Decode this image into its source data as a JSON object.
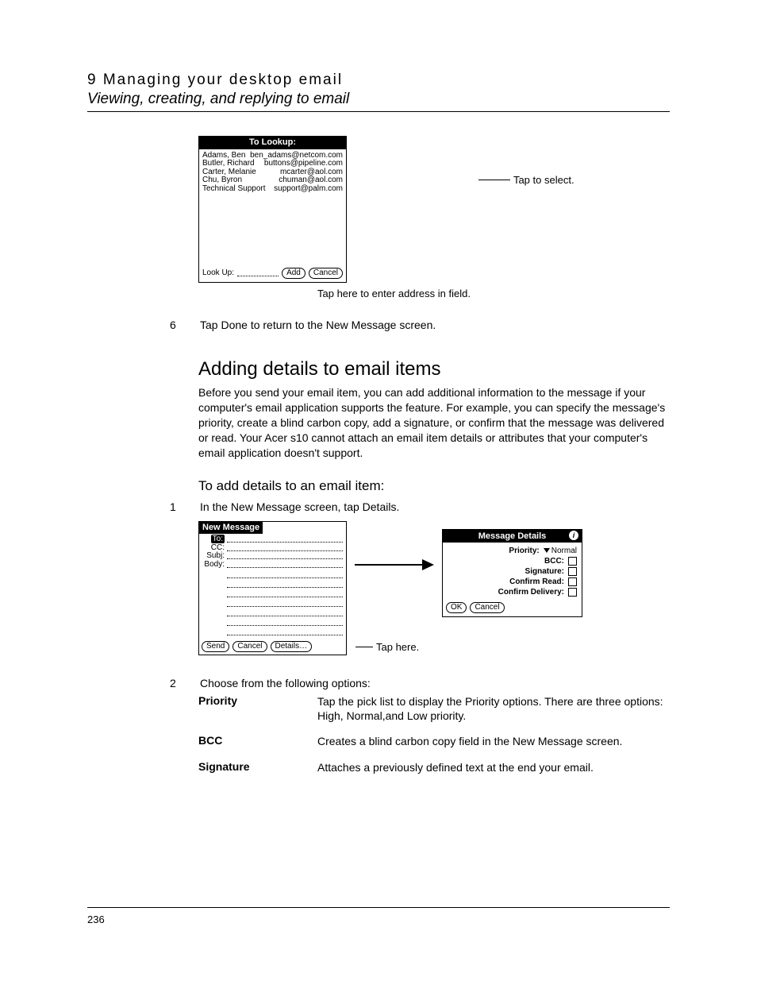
{
  "header": {
    "chapter": "9 Managing your desktop email",
    "subtitle": "Viewing, creating, and replying to email"
  },
  "lookup_screen": {
    "title": "To Lookup:",
    "contacts": [
      {
        "name": "Adams, Ben",
        "email": "ben_adams@netcom.com"
      },
      {
        "name": "Butler, Richard",
        "email": "buttons@pipeline.com"
      },
      {
        "name": "Carter, Melanie",
        "email": "mcarter@aol.com"
      },
      {
        "name": "Chu, Byron",
        "email": "chuman@aol.com"
      },
      {
        "name": "Technical Support",
        "email": "support@palm.com"
      }
    ],
    "lookup_label": "Look Up:",
    "add_btn": "Add",
    "cancel_btn": "Cancel",
    "callout_right": "Tap to select.",
    "caption_below": "Tap here to enter address in field."
  },
  "step6": {
    "num": "6",
    "text": "Tap Done to return to the New Message screen."
  },
  "section": {
    "heading": "Adding details to email items",
    "paragraph": "Before you send your email item, you can add additional information to the message if your computer's email application supports the feature. For example, you can specify the message's priority, create a blind carbon copy, add a signature, or confirm that the message was delivered or read. Your Acer s10 cannot attach an email item details or attributes that your computer's email application doesn't support."
  },
  "subsection": {
    "heading": "To add details to an email item:"
  },
  "step1": {
    "num": "1",
    "text": "In the New Message screen, tap Details."
  },
  "new_message": {
    "title": "New Message",
    "to": "To:",
    "cc": "CC:",
    "subj": "Subj:",
    "body": "Body:",
    "send": "Send",
    "cancel": "Cancel",
    "details": "Details…",
    "tap_here": "Tap here."
  },
  "message_details": {
    "title": "Message Details",
    "priority_label": "Priority:",
    "priority_value": "Normal",
    "bcc": "BCC:",
    "signature": "Signature:",
    "confirm_read": "Confirm Read:",
    "confirm_delivery": "Confirm Delivery:",
    "ok": "OK",
    "cancel": "Cancel"
  },
  "step2": {
    "num": "2",
    "text": "Choose from the following options:"
  },
  "options": [
    {
      "term": "Priority",
      "def": "Tap the pick list to display the Priority options. There are three options: High, Normal,and Low priority."
    },
    {
      "term": "BCC",
      "def": "Creates a blind carbon copy field in the New Message screen."
    },
    {
      "term": "Signature",
      "def": "Attaches a previously defined text at the end your email."
    }
  ],
  "page_number": "236"
}
